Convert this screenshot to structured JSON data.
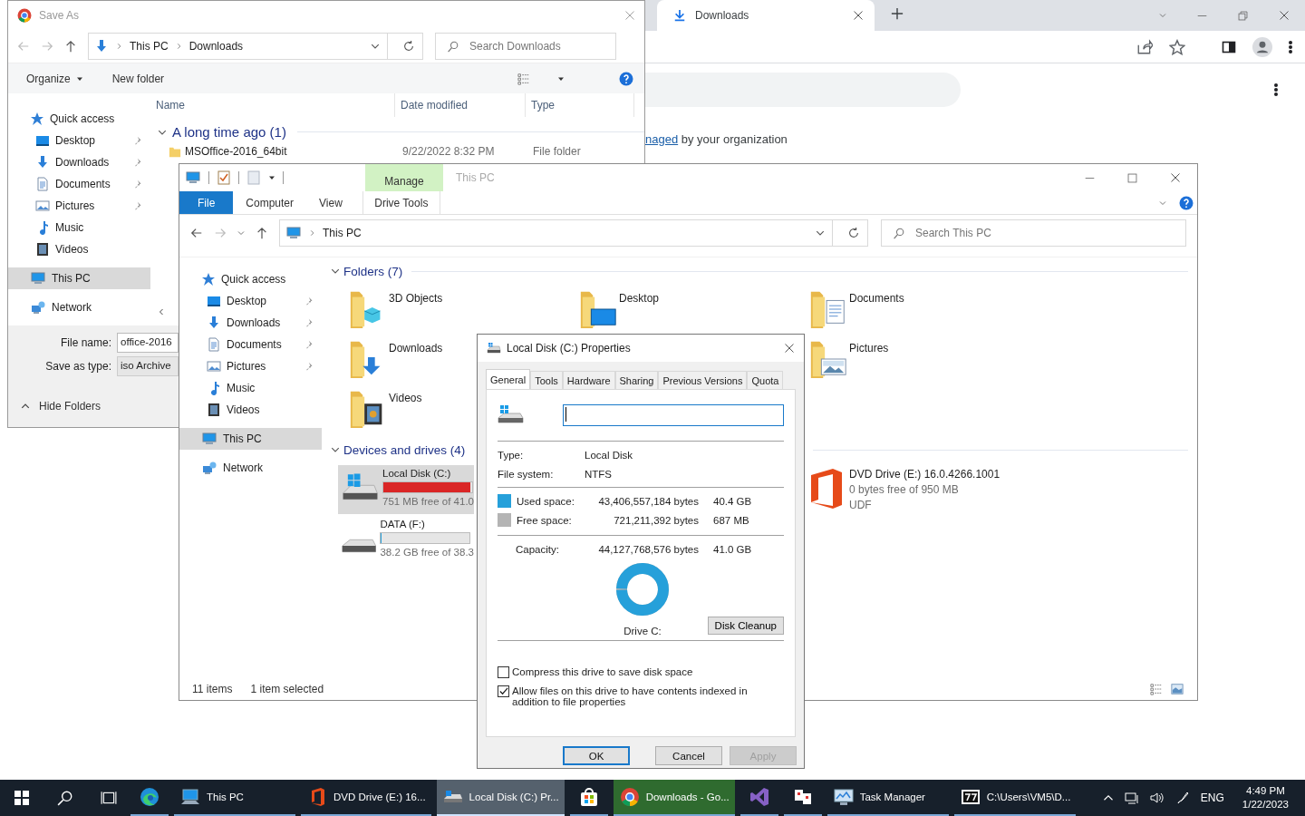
{
  "browser": {
    "tab": {
      "title": "Downloads"
    },
    "notice": {
      "link": "naged",
      "text": "by your organization"
    }
  },
  "save_dialog": {
    "title": "Save As",
    "path": [
      "This PC",
      "Downloads"
    ],
    "search": {
      "placeholder": "Search Downloads"
    },
    "toolbar": [
      "Organize",
      "New folder"
    ],
    "columns": [
      "Name",
      "Date modified",
      "Type"
    ],
    "group": "A long time ago (1)",
    "rows": [
      {
        "name": "MSOffice-2016_64bit",
        "date": "9/22/2022 8:32 PM",
        "type": "File folder"
      }
    ],
    "nav": [
      {
        "label": "Quick access",
        "selected": false,
        "children": [
          {
            "label": "Desktop",
            "pinned": true
          },
          {
            "label": "Downloads",
            "pinned": true
          },
          {
            "label": "Documents",
            "pinned": true
          },
          {
            "label": "Pictures",
            "pinned": true
          },
          {
            "label": "Music",
            "pinned": false
          },
          {
            "label": "Videos",
            "pinned": false
          }
        ]
      },
      {
        "label": "This PC",
        "selected": true
      },
      {
        "label": "Network",
        "selected": false
      }
    ],
    "file_name": {
      "label": "File name:",
      "value": "office-2016"
    },
    "save_type": {
      "label": "Save as type:",
      "value": "iso Archive"
    },
    "hide_folders": "Hide Folders"
  },
  "explorer": {
    "title": "This PC",
    "context_tab": "Manage",
    "tabs": [
      {
        "label": "File",
        "selected": true
      },
      {
        "label": "Computer",
        "selected": false
      },
      {
        "label": "View",
        "selected": false
      },
      {
        "label": "Drive Tools",
        "selected": false
      }
    ],
    "address": "This PC",
    "search": {
      "placeholder": "Search This PC"
    },
    "nav": [
      {
        "label": "Quick access",
        "selected": false,
        "children": [
          {
            "label": "Desktop",
            "pinned": true
          },
          {
            "label": "Downloads",
            "pinned": true
          },
          {
            "label": "Documents",
            "pinned": true
          },
          {
            "label": "Pictures",
            "pinned": true
          },
          {
            "label": "Music",
            "pinned": false
          },
          {
            "label": "Videos",
            "pinned": false
          }
        ]
      },
      {
        "label": "This PC",
        "selected": true
      },
      {
        "label": "Network",
        "selected": false
      }
    ],
    "folders_header": "Folders (7)",
    "folders": [
      {
        "name": "3D Objects"
      },
      {
        "name": "Desktop"
      },
      {
        "name": "Documents"
      },
      {
        "name": "Downloads"
      },
      {
        "name": "Pictures"
      },
      {
        "name": "Videos"
      }
    ],
    "drives_header": "Devices and drives (4)",
    "drives": [
      {
        "kind": "system_disk",
        "name": "Local Disk (C:)",
        "free": "751 MB free of 41.0",
        "level": 0.984,
        "selected": true
      },
      {
        "kind": "dvd",
        "name": "DVD Drive (E:) 16.0.4266.1001",
        "free": "0 bytes free of 950 MB",
        "file_system": "UDF",
        "selected": false
      },
      {
        "kind": "disk",
        "name": "DATA (F:)",
        "free": "38.2 GB free of 38.3",
        "level": 0.003,
        "selected": false
      }
    ],
    "status": [
      "11 items",
      "1 item selected"
    ]
  },
  "properties": {
    "title": "Local Disk (C:) Properties",
    "tabs": [
      {
        "label": "General",
        "selected": true
      },
      {
        "label": "Tools",
        "selected": false
      },
      {
        "label": "Hardware",
        "selected": false
      },
      {
        "label": "Sharing",
        "selected": false
      },
      {
        "label": "Previous Versions",
        "selected": false
      },
      {
        "label": "Quota",
        "selected": false
      }
    ],
    "info": [
      {
        "label": "Type:",
        "value": "Local Disk"
      },
      {
        "label": "File system:",
        "value": "NTFS"
      }
    ],
    "space": [
      {
        "label": "Used space:",
        "bytes": "43,406,557,184 bytes",
        "size": "40.4 GB",
        "color": "#26a0da"
      },
      {
        "label": "Free space:",
        "bytes": "721,211,392 bytes",
        "size": "687 MB",
        "color": "#b4b4b4"
      }
    ],
    "capacity": {
      "label": "Capacity:",
      "bytes": "44,127,768,576 bytes",
      "size": "41.0 GB"
    },
    "usage": {
      "level": 0.984
    },
    "drive_label": "Drive C:",
    "cleanup": "Disk Cleanup",
    "options": [
      {
        "label": "Compress this drive to save disk space",
        "checked": false
      },
      {
        "label": "Allow files on this drive to have contents indexed in addition to file properties",
        "checked": true
      }
    ],
    "buttons": [
      {
        "label": "OK",
        "default": true,
        "disabled": false
      },
      {
        "label": "Cancel",
        "default": false,
        "disabled": false
      },
      {
        "label": "Apply",
        "default": false,
        "disabled": true
      }
    ]
  },
  "taskbar": {
    "items": [
      {
        "selected": false,
        "highlighted": false
      },
      {
        "label": "This PC",
        "selected": false,
        "highlighted": false
      },
      {
        "label": "DVD Drive (E:) 16...",
        "selected": false,
        "highlighted": false
      },
      {
        "label": "Local Disk (C:) Pr...",
        "selected": true,
        "highlighted": false
      },
      {
        "selected": false,
        "highlighted": false
      },
      {
        "label": "Downloads - Go...",
        "selected": false,
        "highlighted": true
      },
      {
        "selected": false,
        "highlighted": false
      },
      {
        "selected": false,
        "highlighted": false
      },
      {
        "label": "Task Manager",
        "selected": false,
        "highlighted": false
      },
      {
        "label": "C:\\Users\\VM5\\D...",
        "selected": false,
        "highlighted": false
      }
    ],
    "language": "ENG",
    "time": "4:49 PM",
    "date": "1/22/2023"
  }
}
